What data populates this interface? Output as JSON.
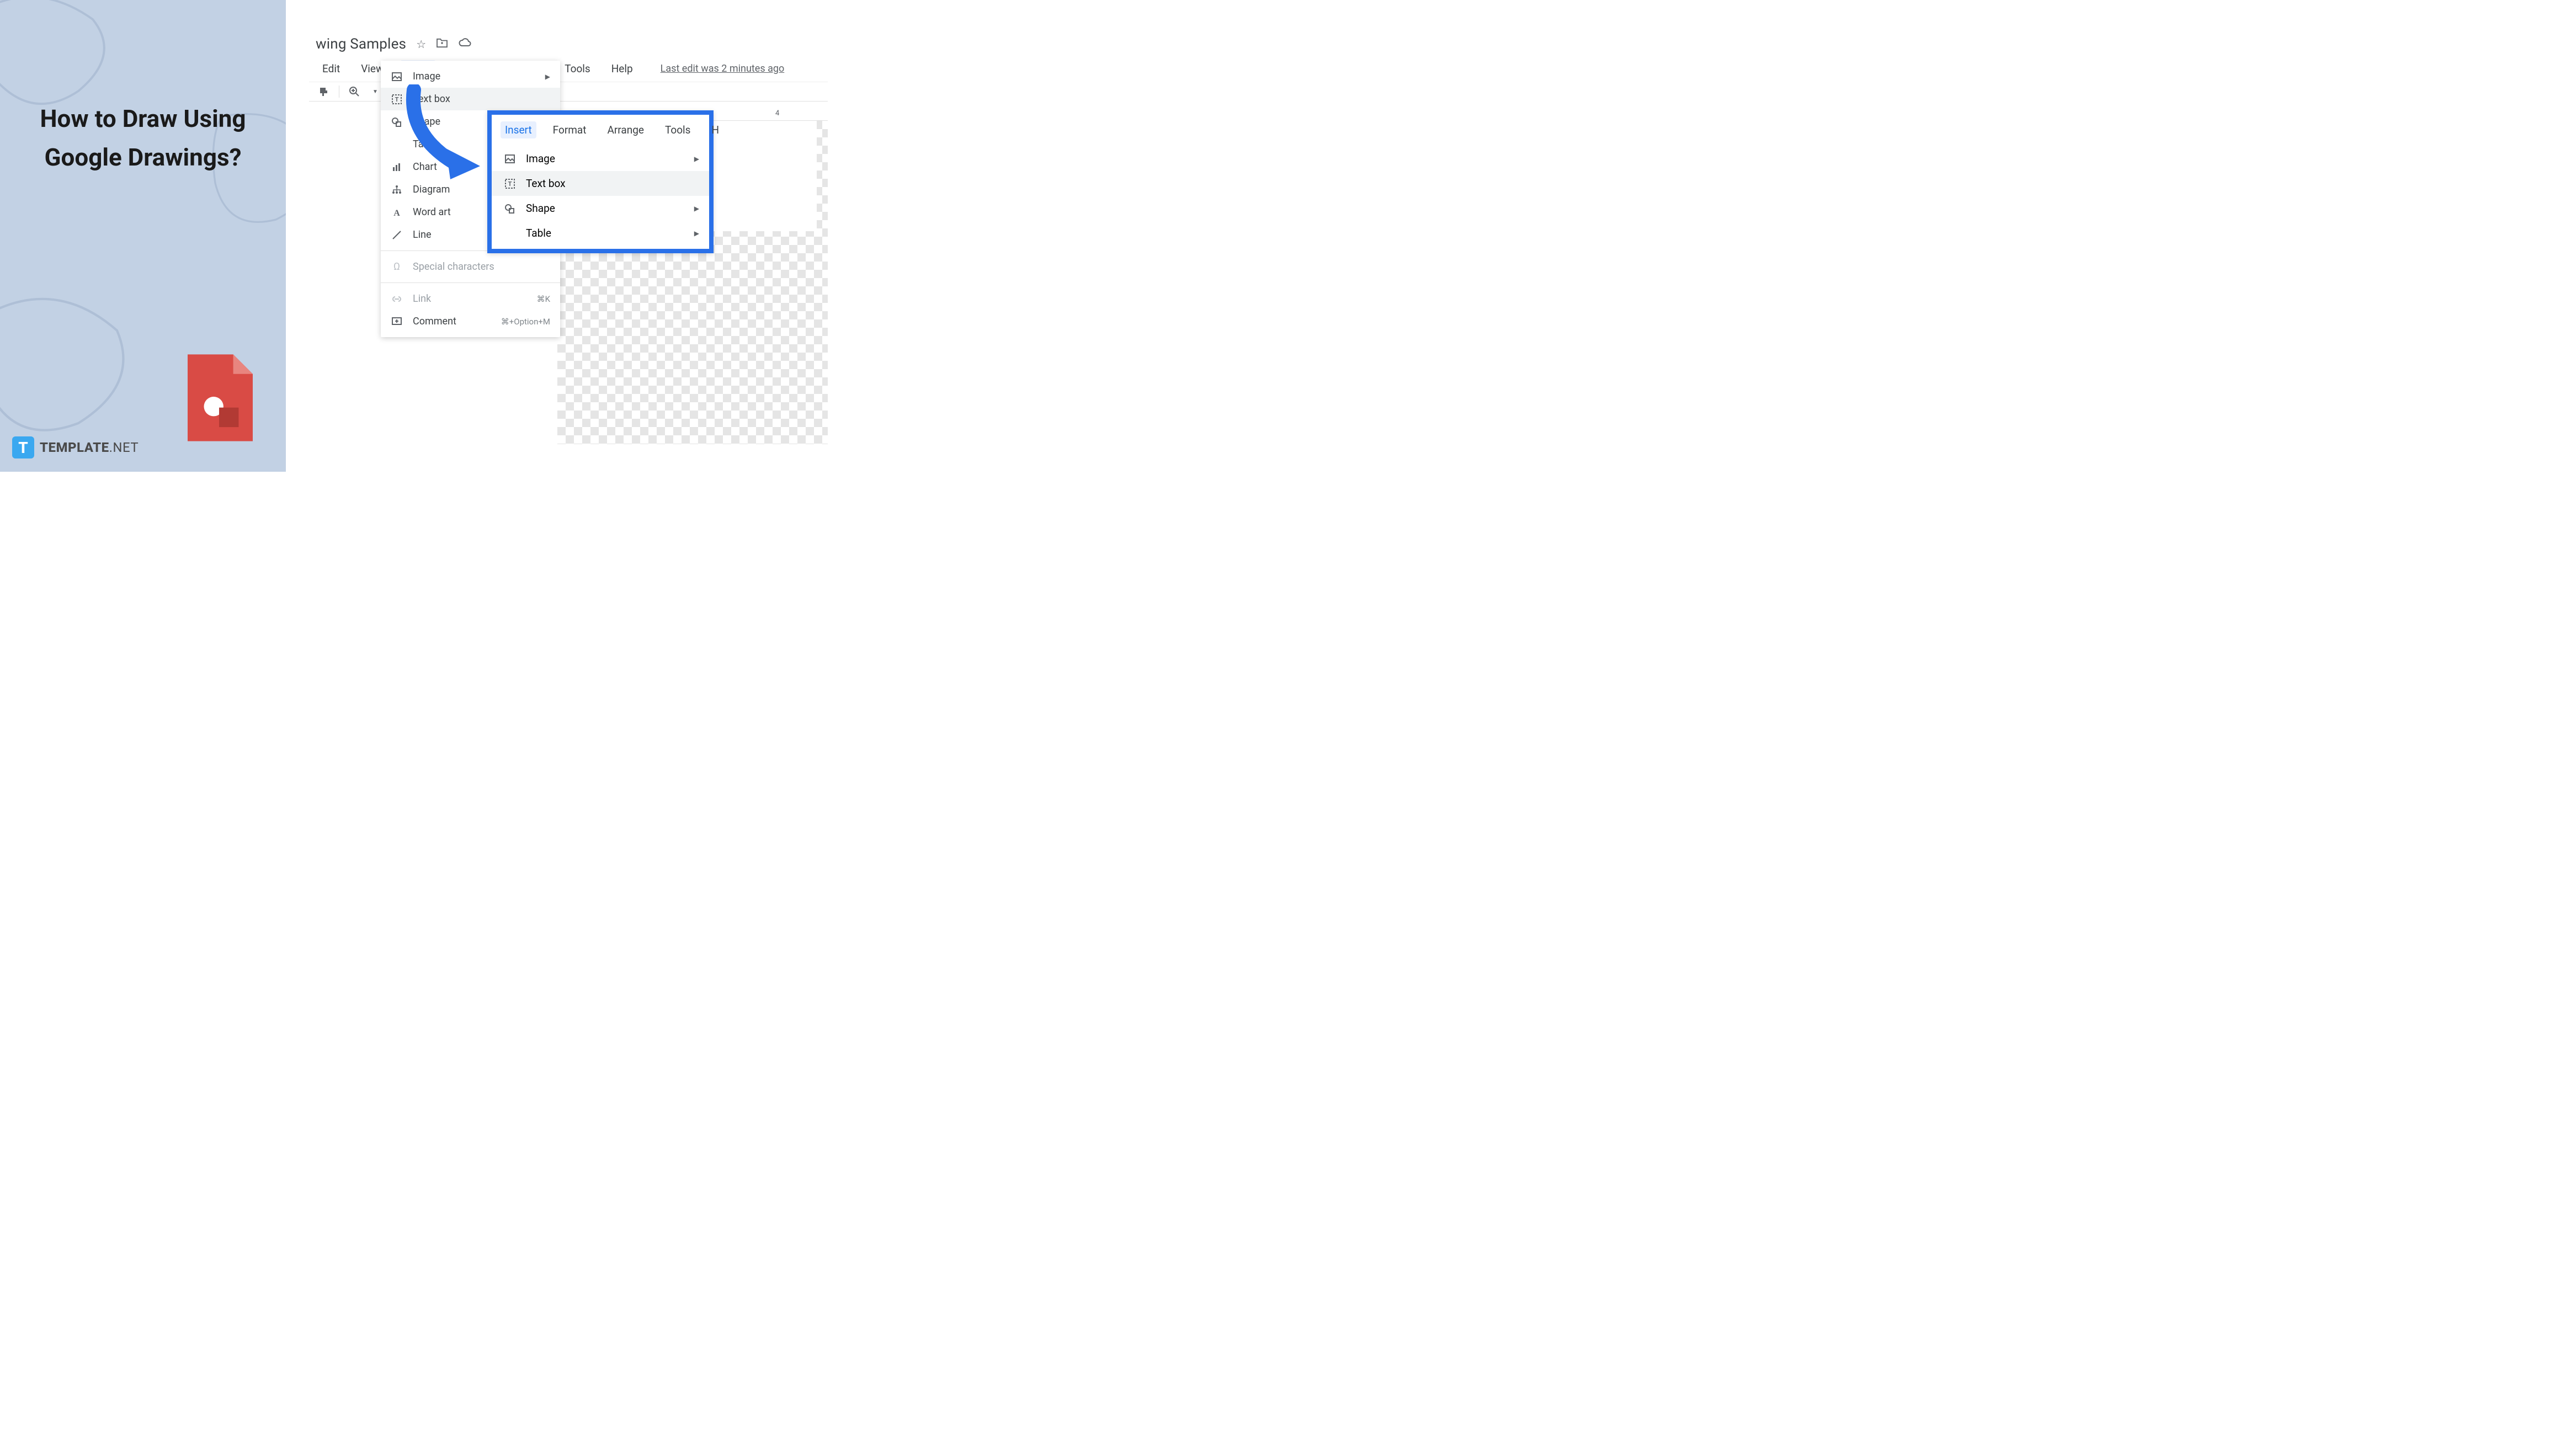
{
  "title": "How to Draw Using Google Drawings?",
  "logo": {
    "mark": "T",
    "text": "TEMPLATE",
    "suffix": ".NET"
  },
  "doc": {
    "title": "wing Samples",
    "last_edit": "Last edit was 2 minutes ago"
  },
  "menubar": {
    "edit": "Edit",
    "view": "View",
    "insert": "Insert",
    "format": "Format",
    "arrange": "Arrange",
    "tools": "Tools",
    "help": "Help"
  },
  "ruler": {
    "mark4": "4"
  },
  "insert_menu": {
    "image": "Image",
    "textbox": "Text box",
    "shape": "Shape",
    "table": "Table",
    "chart": "Chart",
    "diagram": "Diagram",
    "wordart": "Word art",
    "line": "Line",
    "special": "Special characters",
    "link": "Link",
    "link_shortcut": "⌘K",
    "comment": "Comment",
    "comment_shortcut": "⌘+Option+M"
  },
  "callout": {
    "insert": "Insert",
    "format": "Format",
    "arrange": "Arrange",
    "tools": "Tools",
    "h": "H",
    "image": "Image",
    "textbox": "Text box",
    "shape": "Shape",
    "table": "Table"
  }
}
